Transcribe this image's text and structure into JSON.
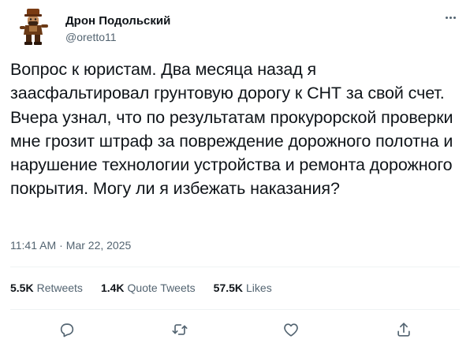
{
  "author": {
    "display_name": "Дрон Подольский",
    "handle": "@oretto11"
  },
  "tweet": {
    "text": "Вопрос к юристам. Два месяца назад я заасфальтировал грунтовую дорогу к СНТ за свой счет. Вчера узнал, что по результатам прокурорской проверки мне грозит штраф за повреждение дорожного полотна и нарушение технологии устройства и ремонта дорожного покрытия. Могу ли я избежать наказания?",
    "time": "11:41 AM",
    "separator": "·",
    "date": "Mar 22, 2025"
  },
  "stats": {
    "retweets_count": "5.5K",
    "retweets_label": "Retweets",
    "quotes_count": "1.4K",
    "quotes_label": "Quote Tweets",
    "likes_count": "57.5K",
    "likes_label": "Likes"
  },
  "icons": {
    "more": "more-horizontal-icon",
    "reply": "reply-icon",
    "retweet": "retweet-icon",
    "like": "heart-icon",
    "share": "share-icon"
  },
  "colors": {
    "text_primary": "#0f1419",
    "text_secondary": "#536471",
    "divider": "#eff3f4"
  }
}
